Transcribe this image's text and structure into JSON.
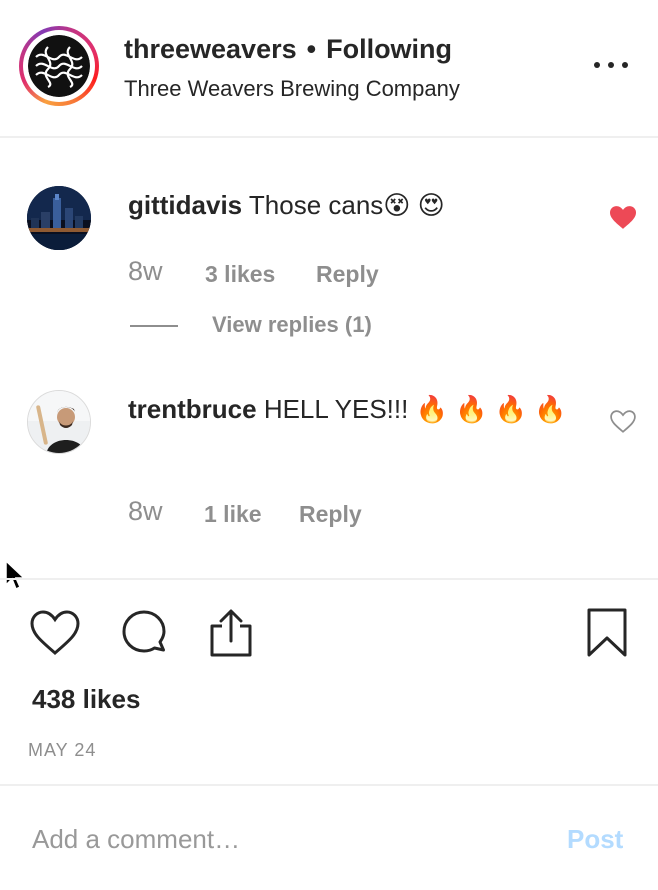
{
  "header": {
    "username": "threeweavers",
    "separator": "•",
    "follow_status": "Following",
    "full_name": "Three Weavers Brewing Company"
  },
  "comments": [
    {
      "username": "gittidavis",
      "text": "Those cans😵 😍",
      "time": "8w",
      "likes": "3 likes",
      "reply": "Reply",
      "view_replies": "View replies (1)",
      "liked": true
    },
    {
      "username": "trentbruce",
      "text": "HELL YES!!! 🔥 🔥 🔥 🔥",
      "time": "8w",
      "likes": "1 like",
      "reply": "Reply",
      "liked": false
    }
  ],
  "post": {
    "likes": "438 likes",
    "date": "MAY 24"
  },
  "composer": {
    "placeholder": "Add a comment…",
    "post_label": "Post"
  },
  "colors": {
    "liked_heart": "#ed4956",
    "post_button_disabled": "#b3dbff",
    "muted_text": "#8e8e8e"
  },
  "icons": {
    "more": "more-options-icon",
    "like": "heart-icon",
    "comment": "comment-bubble-icon",
    "share": "share-icon",
    "save": "bookmark-icon"
  }
}
